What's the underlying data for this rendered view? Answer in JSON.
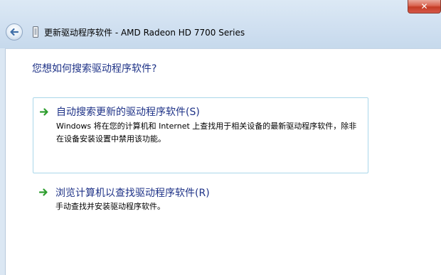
{
  "window": {
    "title": "更新驱动程序软件 - AMD Radeon HD 7700 Series",
    "close_symbol": "✕",
    "back_icon": "back-arrow-icon",
    "window_icon": "hardware-device-icon"
  },
  "main": {
    "heading": "您想如何搜索驱动程序软件?",
    "options": [
      {
        "title": "自动搜索更新的驱动程序软件(S)",
        "description": "Windows 将在您的计算机和 Internet 上查找用于相关设备的最新驱动程序软件，除非在设备安装设置中禁用该功能。",
        "icon": "green-arrow-icon"
      },
      {
        "title": "浏览计算机以查找驱动程序软件(R)",
        "description": "手动查找并安装驱动程序软件。",
        "icon": "green-arrow-icon"
      }
    ]
  },
  "colors": {
    "link_blue": "#1e3287",
    "arrow_green": "#2e9e2e",
    "option_border": "#aad7ea"
  }
}
